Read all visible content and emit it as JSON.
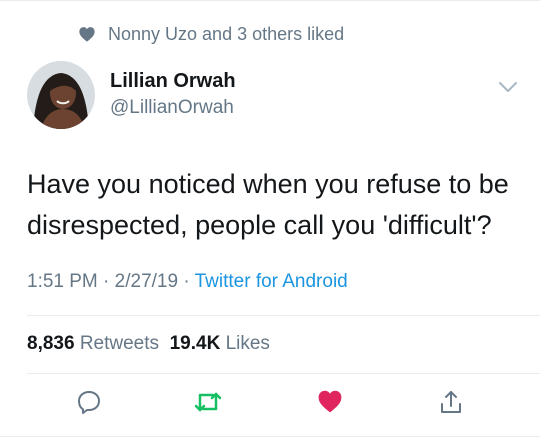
{
  "social_context": {
    "text": "Nonny Uzo and 3 others liked",
    "icon": "heart-icon"
  },
  "author": {
    "name": "Lillian Orwah",
    "handle": "@LillianOrwah"
  },
  "tweet": {
    "line1": "Have you noticed when you refuse to be",
    "line2": "disrespected, people call you 'difficult'?"
  },
  "meta": {
    "time": "1:51 PM",
    "sep1": " · ",
    "date": "2/27/19",
    "sep2": " · ",
    "source": "Twitter for Android"
  },
  "stats": {
    "retweets_count": "8,836",
    "retweets_label": "Retweets",
    "likes_count": "19.4K",
    "likes_label": "Likes"
  },
  "actions": {
    "reply_icon": "reply-icon",
    "retweet_icon": "retweet-icon",
    "like_icon": "heart-icon",
    "share_icon": "share-icon"
  },
  "colors": {
    "accent": "#1b95e0",
    "retweet_green": "#17bf63",
    "like_red": "#e0245e",
    "muted": "#657786",
    "text": "#14171a"
  }
}
